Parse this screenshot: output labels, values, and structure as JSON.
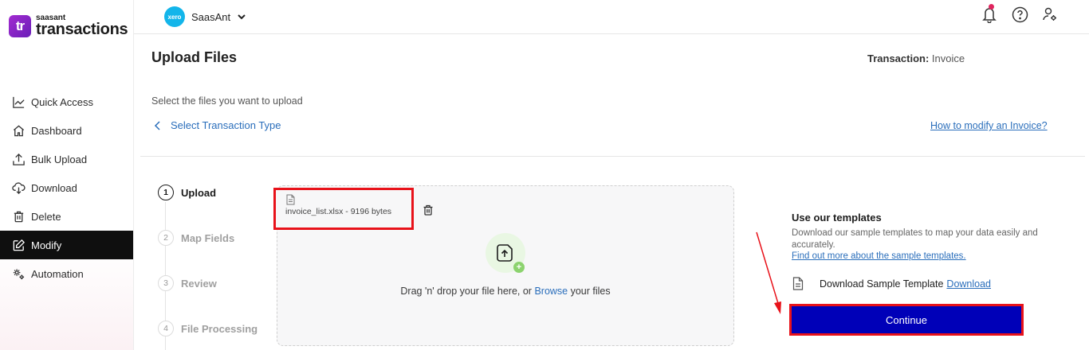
{
  "app": {
    "brand": "saasant",
    "product": "transactions",
    "logo_mark": "tr"
  },
  "header": {
    "org_name": "SaasAnt",
    "org_logo_text": "xero",
    "icons": [
      "bell-icon",
      "help-icon",
      "user-settings-icon"
    ]
  },
  "sidebar": {
    "items": [
      {
        "label": "Quick Access",
        "icon": "chart-line-icon",
        "active": false
      },
      {
        "label": "Dashboard",
        "icon": "home-icon",
        "active": false
      },
      {
        "label": "Bulk Upload",
        "icon": "upload-icon",
        "active": false
      },
      {
        "label": "Download",
        "icon": "cloud-download-icon",
        "active": false
      },
      {
        "label": "Delete",
        "icon": "trash-icon",
        "active": false
      },
      {
        "label": "Modify",
        "icon": "edit-icon",
        "active": true
      },
      {
        "label": "Automation",
        "icon": "gears-icon",
        "active": false
      }
    ]
  },
  "main": {
    "title": "Upload Files",
    "transaction_label": "Transaction:",
    "transaction_value": "Invoice",
    "subtitle": "Select the files you want to upload",
    "back_link": "Select Transaction Type",
    "help_link": "How to modify an Invoice?"
  },
  "stepper": {
    "steps": [
      {
        "num": "1",
        "label": "Upload",
        "active": true
      },
      {
        "num": "2",
        "label": "Map Fields",
        "active": false
      },
      {
        "num": "3",
        "label": "Review",
        "active": false
      },
      {
        "num": "4",
        "label": "File Processing",
        "active": false
      }
    ]
  },
  "dropzone": {
    "file_name": "invoice_list.xlsx - 9196 bytes",
    "text_before": "Drag 'n' drop your file here, or ",
    "browse": "Browse",
    "text_after": " your files"
  },
  "templates": {
    "title": "Use our templates",
    "description": "Download our sample templates to map your data easily and accurately.",
    "learn_more": "Find out more about the sample templates.",
    "sample_label": "Download Sample Template",
    "download_link": "Download",
    "continue_label": "Continue"
  },
  "colors": {
    "accent_link": "#2a6ebb",
    "continue_bg": "#0000b8",
    "highlight": "#e8121a",
    "active_nav": "#0f0f0f"
  }
}
